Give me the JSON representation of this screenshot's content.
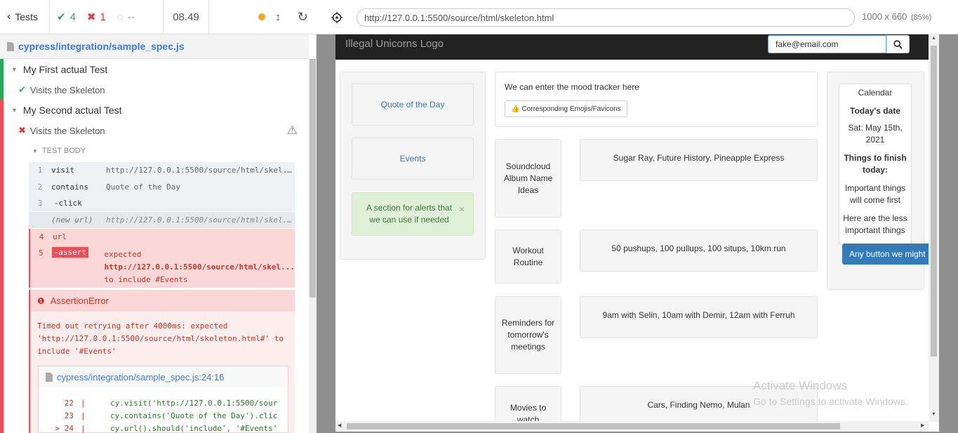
{
  "reporter": {
    "tests_label": "Tests",
    "passed": "4",
    "failed": "1",
    "pending": "--",
    "duration": "08.49",
    "spec_path": "cypress/integration/sample_spec.js",
    "suites": [
      {
        "title": "My First actual Test",
        "test": "Visits the Skeleton",
        "state": "passed"
      },
      {
        "title": "My Second actual Test",
        "test": "Visits the Skeleton",
        "state": "failed"
      }
    ],
    "test_body_label": "TEST BODY",
    "commands": [
      {
        "num": "1",
        "name": "visit",
        "msg": "http://127.0.0.1:5500/source/html/skel..."
      },
      {
        "num": "2",
        "name": "contains",
        "msg": "Quote of the Day"
      },
      {
        "num": "3",
        "name": "-click",
        "msg": ""
      },
      {
        "num": "",
        "name": "(new url)",
        "msg": "http://127.0.0.1:5500/source/html/skel..."
      },
      {
        "num": "4",
        "name": "url",
        "msg": ""
      },
      {
        "num": "5",
        "name": "-assert",
        "msg_line1": "expected",
        "msg_line2": "http://127.0.0.1:5500/source/html/skel...",
        "msg_line3": "to include #Events"
      }
    ],
    "error": {
      "title": "AssertionError",
      "message": "Timed out retrying after 4000ms: expected 'http://127.0.0.1:5500/source/html/skeleton.html#' to include '#Events'",
      "file": "cypress/integration/sample_spec.js:24:16",
      "code_lines": [
        {
          "n": "22",
          "code": "cy.visit('http://127.0.0.1:5500/sour"
        },
        {
          "n": "23",
          "code": "cy.contains('Quote of the Day').clic"
        },
        {
          "n": "24",
          "code": "cy.url().should('include', '#Events'"
        }
      ]
    }
  },
  "aut": {
    "url": "http://127.0.0.1:5500/source/html/skeleton.html",
    "viewport": "1000 x 660",
    "scale": "(85%)",
    "logo": "Illegal Unicorns Logo",
    "email_value": "fake@email.com",
    "left": {
      "quote": "Quote of the Day",
      "events": "Events",
      "alert": "A section for alerts that we can use if needed"
    },
    "mood": {
      "text": "We can enter the mood tracker here",
      "button": "Corresponding Emojis/Favicons"
    },
    "rows": [
      {
        "label": "Soundcloud Album Name Ideas",
        "value": "Sugar Ray, Future History, Pineapple Express"
      },
      {
        "label": "Workout Routine",
        "value": "50 pushups, 100 pullups, 100 situps, 10km run"
      },
      {
        "label": "Reminders for tomorrow's meetings",
        "value": "9am with Selin, 10am with Demir, 12am with Ferruh"
      },
      {
        "label": "Movies to watch",
        "value": "Cars, Finding Nemo, Mulan"
      }
    ],
    "calendar": {
      "title": "Calendar",
      "date_heading": "Today's date",
      "date": "Sat: May 15th, 2021",
      "todo_heading": "Things to finish today:",
      "important": "Important things will come first",
      "less": "Here are the less important things",
      "button": "Any button we might"
    }
  },
  "watermark": {
    "line1": "Activate Windows",
    "line2": "Go to Settings to activate Windows."
  },
  "colors": {
    "pass": "#2ca55c",
    "fail": "#e94f5b",
    "link": "#337ab7",
    "navbar": "#222222"
  }
}
